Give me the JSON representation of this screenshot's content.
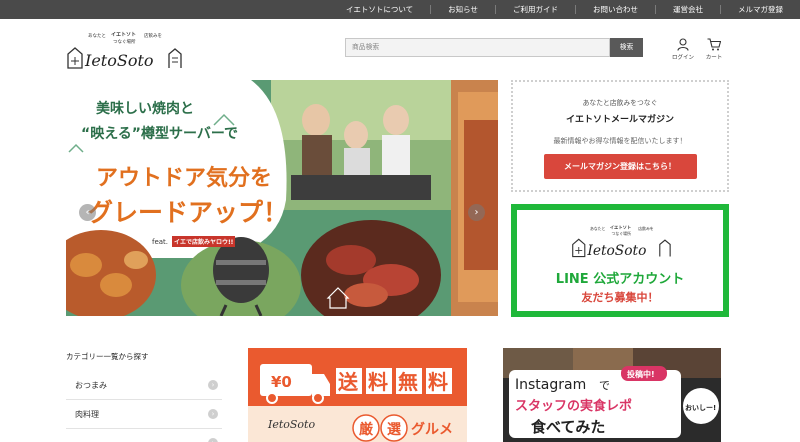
{
  "topnav": {
    "items": [
      "イエトソトについて",
      "お知らせ",
      "ご利用ガイド",
      "お問い合わせ",
      "運営会社",
      "メルマガ登録"
    ]
  },
  "logo": {
    "tagline_left": "あなたと",
    "tagline_mid": "イエトソト",
    "tagline_right": "店飲みを",
    "tagline_sub": "つなぐ場所",
    "wordmark": "IetoSoto"
  },
  "search": {
    "placeholder": "商品検索",
    "button": "検索"
  },
  "header_icons": {
    "login": "ログイン",
    "cart": "カート"
  },
  "hero": {
    "line1": "美味しい焼肉と",
    "line2": "“映える”樽型サーバーで",
    "line3": "アウトドア気分を",
    "line4": "グレードアップ！",
    "feat_label": "feat.",
    "feat_brand": "イエで店飲みヤロウ!!",
    "prev_arrow": "‹",
    "next_arrow": "›"
  },
  "mailmag": {
    "subtitle": "あなたと店飲みをつなぐ",
    "title": "イエトソトメールマガジン",
    "description": "最新情報やお得な情報を配信いたします！",
    "cta": "メールマガジン登録はこちら！"
  },
  "line_box": {
    "line1": "LINE 公式アカウント",
    "line2": "友だち募集中！"
  },
  "categories": {
    "title": "カテゴリー一覧から探す",
    "items": [
      "おつまみ",
      "肉料理"
    ]
  },
  "promo_shipping": {
    "price": "¥0",
    "headline": "送料無料",
    "sub1": "厳",
    "sub2": "選",
    "sub3": "グルメ"
  },
  "promo_instagram": {
    "brand": "Instagram",
    "de": "で",
    "line2": "スタッフの実食レポ",
    "line3": "食べてみた",
    "badge": "投稿中!",
    "side": "おいしー!"
  },
  "colors": {
    "topbar": "#4a4a4a",
    "hero_green": "#5a9a73",
    "cta_red": "#d9473c",
    "line_green": "#1fb83a",
    "promo_orange": "#ea5a2f"
  }
}
